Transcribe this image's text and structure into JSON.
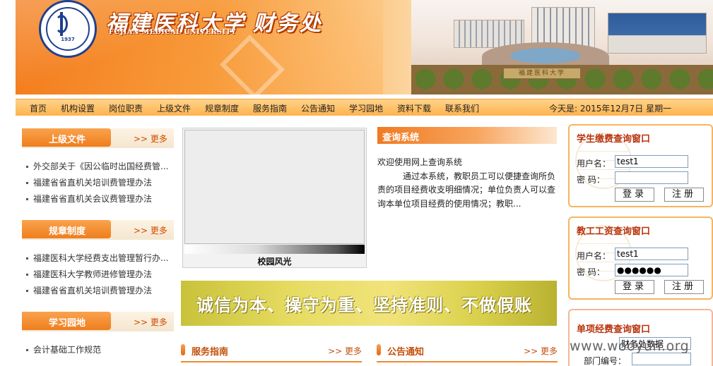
{
  "header": {
    "title": "福建医科大学",
    "dept": "财务处",
    "subtitle": "FUJIAN MEDICAL UNIVERSITY",
    "logo_year": "1937",
    "gate_text": "福建医科大学"
  },
  "nav": {
    "items": [
      "首页",
      "机构设置",
      "岗位职责",
      "上级文件",
      "规章制度",
      "服务指南",
      "公告通知",
      "学习园地",
      "资料下载",
      "联系我们"
    ],
    "date": "今天是: 2015年12月7日 星期一"
  },
  "left": {
    "more_label": ">> 更多",
    "boxes": [
      {
        "title": "上级文件",
        "items": [
          "外交部关于《因公临时出国经费管...",
          "福建省省直机关培训费管理办法",
          "福建省省直机关会议费管理办法"
        ]
      },
      {
        "title": "规章制度",
        "items": [
          "福建医科大学经费支出管理暂行办...",
          "福建医科大学教师进修管理办法",
          "福建省省直机关培训费管理办法"
        ]
      },
      {
        "title": "学习园地",
        "items": [
          "会计基础工作规范"
        ]
      }
    ]
  },
  "photo": {
    "caption": "校园风光"
  },
  "query": {
    "title": "查询系统",
    "welcome": "欢迎使用网上查询系统",
    "desc": "通过本系统，教职员工可以便捷查询所负责的项目经费收支明细情况；单位负责人可以查询本单位项目经费的使用情况；教职..."
  },
  "slogan": "诚信为本、操守为重、坚持准则、不做假账",
  "sections": [
    {
      "title": "服务指南",
      "more": ">> 更多"
    },
    {
      "title": "公告通知",
      "more": ">> 更多"
    }
  ],
  "student_panel": {
    "title": "学生缴费查询窗口",
    "user_label": "用户名：",
    "pass_label": "密  码：",
    "username": "test1",
    "password": "",
    "login": "登录",
    "register": "注册"
  },
  "staff_panel": {
    "title": "教工工资查询窗口",
    "user_label": "用户名：",
    "pass_label": "密  码：",
    "username": "test1",
    "password": "●●●●●●",
    "login": "登录",
    "register": "注册"
  },
  "project_panel": {
    "title": "单项经费查询窗口",
    "field_value": "财务处数据",
    "dept_label": "部门编号："
  },
  "watermark": "www.wooyun.org"
}
